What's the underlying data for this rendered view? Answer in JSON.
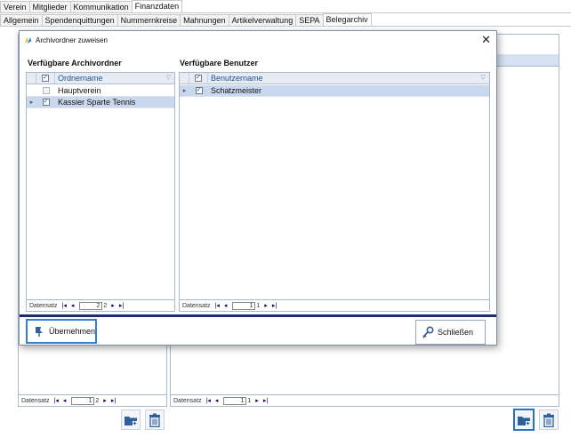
{
  "tabs_top": [
    "Verein",
    "Mitglieder",
    "Kommunikation",
    "Finanzdaten"
  ],
  "tabs_top_active": 3,
  "tabs_sub": [
    "Allgemein",
    "Spendenquittungen",
    "Nummernkreise",
    "Mahnungen",
    "Artikelverwaltung",
    "SEPA",
    "Belegarchiv"
  ],
  "tabs_sub_active": 6,
  "background": {
    "left_nav": {
      "label": "Datensatz",
      "page": "1",
      "total": "2"
    },
    "right_nav": {
      "label": "Datensatz",
      "page": "1",
      "total": "1"
    }
  },
  "dialog": {
    "title": "Archivordner zuweisen",
    "close_glyph": "✕",
    "folders": {
      "heading": "Verfügbare Archivordner",
      "column": "Ordnername",
      "rows": [
        {
          "name": "Hauptverein",
          "checked": false,
          "selected": false
        },
        {
          "name": "Kassier Sparte Tennis",
          "checked": true,
          "selected": true
        }
      ],
      "nav": {
        "label": "Datensatz",
        "page": "2",
        "total": "2"
      }
    },
    "users": {
      "heading": "Verfügbare Benutzer",
      "column": "Benutzername",
      "rows": [
        {
          "name": "Schatzmeister",
          "checked": true,
          "selected": true
        }
      ],
      "nav": {
        "label": "Datensatz",
        "page": "1",
        "total": "1"
      }
    },
    "apply_label": "Übernehmen",
    "close_label": "Schließen"
  },
  "colors": {
    "accent": "#2a6fc2",
    "separator": "#1b2e6e",
    "selection": "#c9d8ef"
  }
}
